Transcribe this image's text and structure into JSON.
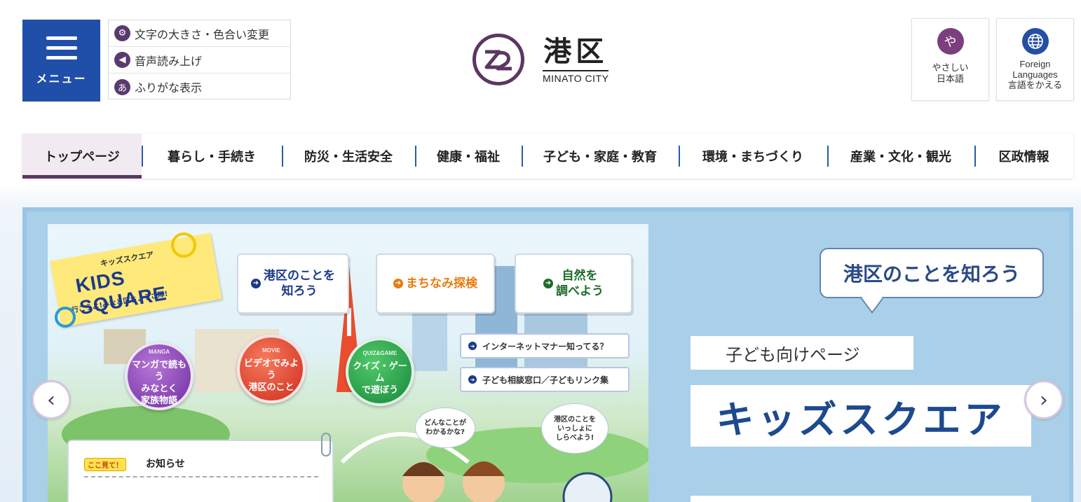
{
  "header": {
    "menu_label": "メニュー",
    "utility_links": [
      {
        "label": "文字の大きさ・色合い変更",
        "icon": "gear-icon"
      },
      {
        "label": "音声読み上げ",
        "icon": "speaker-icon"
      },
      {
        "label": "ふりがな表示",
        "icon": "furigana-icon"
      }
    ],
    "logo": {
      "jp": "港区",
      "en": "MINATO CITY"
    },
    "yasashii": {
      "icon_char": "や",
      "label": "やさしい\n日本語"
    },
    "foreign": {
      "label": "Foreign\nLanguages\n言語をかえる"
    }
  },
  "nav": {
    "items": [
      {
        "label": "トップページ",
        "active": true
      },
      {
        "label": "暮らし・手続き",
        "active": false
      },
      {
        "label": "防災・生活安全",
        "active": false
      },
      {
        "label": "健康・福祉",
        "active": false
      },
      {
        "label": "子ども・家庭・教育",
        "active": false
      },
      {
        "label": "環境・まちづくり",
        "active": false
      },
      {
        "label": "産業・文化・観光",
        "active": false
      },
      {
        "label": "区政情報",
        "active": false
      }
    ]
  },
  "slide": {
    "kids": {
      "small": "キッズスクエア",
      "main": "KIDS SQUARE",
      "sub": "行こうよ!みなと区ちょうさ隊!"
    },
    "cards": [
      {
        "label": "港区のことを\n知ろう"
      },
      {
        "label": "まちなみ探検"
      },
      {
        "label": "自然を\n調べよう"
      }
    ],
    "bubbles": [
      {
        "tag": "MANGA",
        "label": "マンガで読もう\nみなとく\n家族物語"
      },
      {
        "tag": "MOVIE",
        "label": "ビデオでみよう\n港区のこと"
      },
      {
        "tag": "QUIZ&GAME",
        "label": "クイズ・ゲーム\nで遊ぼう"
      }
    ],
    "pills": [
      {
        "label": "インターネットマナー知ってる？"
      },
      {
        "label": "子ども相談窓口／子どもリンク集"
      }
    ],
    "speech": [
      {
        "label": "どんなことが\nわかるかな?"
      },
      {
        "label": "港区のことを\nいっしょに\nしらべよう!"
      }
    ],
    "news": {
      "tag": "ここ見て！",
      "title": "お知らせ"
    },
    "catch": "港区のことを知ろう",
    "subtitle": "子ども向けページ",
    "title": "キッズスクエア",
    "prev": "‹",
    "next": "›"
  },
  "colors": {
    "menu_blue": "#1f4fa8",
    "brand_purple": "#5b3761",
    "nav_divider": "#2b5aa8",
    "slider_frame": "#99c5e6"
  }
}
